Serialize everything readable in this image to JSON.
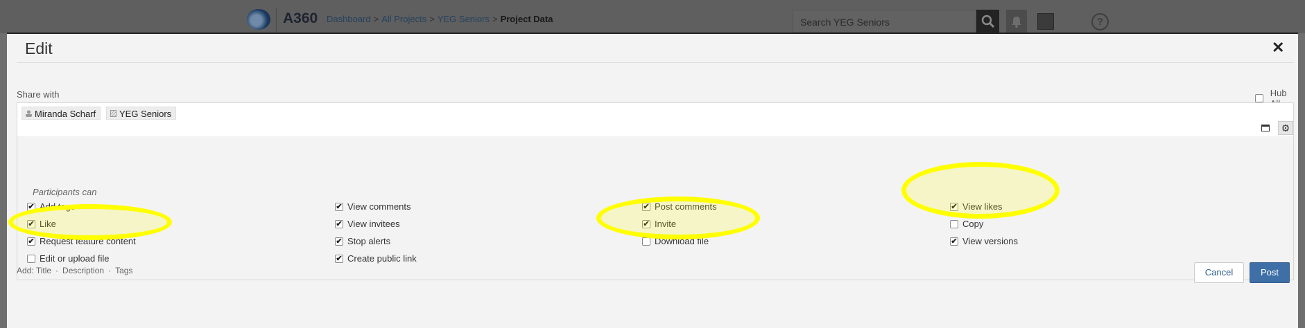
{
  "header": {
    "app_title": "A360",
    "breadcrumbs": [
      "Dashboard",
      "All Projects",
      "YEG Seniors"
    ],
    "breadcrumb_separator": ">",
    "current_page": "Project Data",
    "search_placeholder": "Search YEG Seniors",
    "help_label": "?"
  },
  "modal": {
    "title": "Edit",
    "close_label": "✕",
    "share_with_label": "Share with",
    "hub_all_label": "Hub All",
    "recipients": [
      "Miranda Scharf",
      "YEG Seniors"
    ],
    "participants_label": "Participants can",
    "permissions": [
      {
        "label": "Add tags",
        "checked": true
      },
      {
        "label": "Like",
        "checked": true
      },
      {
        "label": "Request feature content",
        "checked": true
      },
      {
        "label": "Edit or upload file",
        "checked": false
      },
      {
        "label": "View comments",
        "checked": true
      },
      {
        "label": "View invitees",
        "checked": true
      },
      {
        "label": "Stop alerts",
        "checked": true
      },
      {
        "label": "Create public link",
        "checked": true
      },
      {
        "label": "Post comments",
        "checked": true
      },
      {
        "label": "Invite",
        "checked": true
      },
      {
        "label": "Download file",
        "checked": false
      },
      {
        "label": "View likes",
        "checked": true
      },
      {
        "label": "Copy",
        "checked": false
      },
      {
        "label": "View versions",
        "checked": true
      }
    ],
    "add_label": "Add:",
    "add_items": [
      "Title",
      "Description",
      "Tags"
    ],
    "add_separator": "·",
    "cancel_label": "Cancel",
    "post_label": "Post",
    "highlight_color": "#ffff00",
    "primary_color": "#3e6fa6"
  }
}
